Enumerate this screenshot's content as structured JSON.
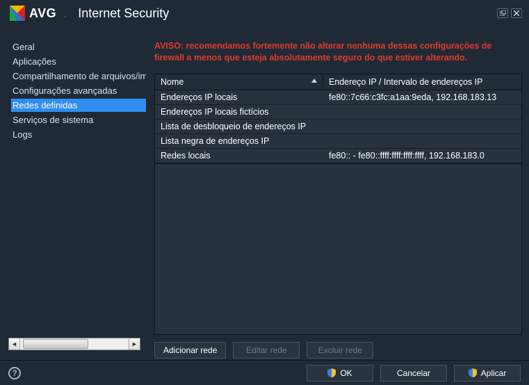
{
  "header": {
    "brand": "AVG",
    "product": "Internet Security"
  },
  "sidebar": {
    "items": [
      {
        "label": "Geral"
      },
      {
        "label": "Aplicações"
      },
      {
        "label": "Compartilhamento de arquivos/impressoras"
      },
      {
        "label": "Configurações avançadas"
      },
      {
        "label": "Redes definidas",
        "selected": true
      },
      {
        "label": "Serviços de sistema"
      },
      {
        "label": "Logs"
      }
    ]
  },
  "main": {
    "warning": "AVISO: recomendamos fortemente não alterar nenhuma dessas configurações de firewall a menos que esteja absolutamente seguro do que estiver alterando.",
    "columns": {
      "name": "Nome",
      "ip": "Endereço IP / Intervalo de endereços IP"
    },
    "rows": [
      {
        "name": "Endereços IP locais",
        "ip": "fe80::7c66:c3fc:a1aa:9eda, 192.168.183.13"
      },
      {
        "name": "Endereços IP locais fictícios",
        "ip": ""
      },
      {
        "name": "Lista de desbloqueio de endereços IP",
        "ip": ""
      },
      {
        "name": "Lista negra de endereços IP",
        "ip": ""
      },
      {
        "name": "Redes locais",
        "ip": "fe80:: - fe80::ffff:ffff:ffff:ffff, 192.168.183.0"
      }
    ],
    "actions": {
      "add": "Adicionar rede",
      "edit": "Editar rede",
      "delete": "Excluir rede"
    }
  },
  "bottom": {
    "ok": "OK",
    "cancel": "Cancelar",
    "apply": "Aplicar"
  }
}
